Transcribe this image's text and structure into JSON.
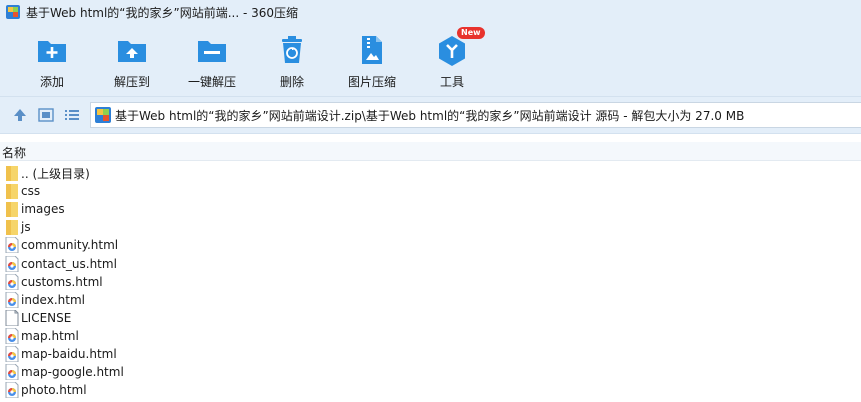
{
  "window": {
    "title": "基于Web html的“我的家乡”网站前端... - 360压缩"
  },
  "toolbar": {
    "items": [
      {
        "label": "添加",
        "icon": "add-icon"
      },
      {
        "label": "解压到",
        "icon": "extract-to-icon"
      },
      {
        "label": "一键解压",
        "icon": "one-click-extract-icon"
      },
      {
        "label": "删除",
        "icon": "delete-icon"
      },
      {
        "label": "图片压缩",
        "icon": "image-compress-icon"
      },
      {
        "label": "工具",
        "icon": "tools-icon",
        "badge": "New"
      }
    ]
  },
  "nav": {
    "path": "基于Web html的“我的家乡”网站前端设计.zip\\基于Web html的“我的家乡”网站前端设计 源码 - 解包大小为 27.0 MB"
  },
  "list": {
    "header_name": "名称",
    "items": [
      {
        "name": ".. (上级目录)",
        "type": "folder"
      },
      {
        "name": "css",
        "type": "folder"
      },
      {
        "name": "images",
        "type": "folder"
      },
      {
        "name": "js",
        "type": "folder"
      },
      {
        "name": "community.html",
        "type": "html"
      },
      {
        "name": "contact_us.html",
        "type": "html"
      },
      {
        "name": "customs.html",
        "type": "html"
      },
      {
        "name": "index.html",
        "type": "html"
      },
      {
        "name": "LICENSE",
        "type": "file"
      },
      {
        "name": "map.html",
        "type": "html"
      },
      {
        "name": "map-baidu.html",
        "type": "html"
      },
      {
        "name": "map-google.html",
        "type": "html"
      },
      {
        "name": "photo.html",
        "type": "html"
      }
    ]
  },
  "colors": {
    "accent": "#2a8ee0",
    "chrome": "#e3eef9",
    "badge": "#e8322d",
    "folder": "#f6d56a"
  }
}
